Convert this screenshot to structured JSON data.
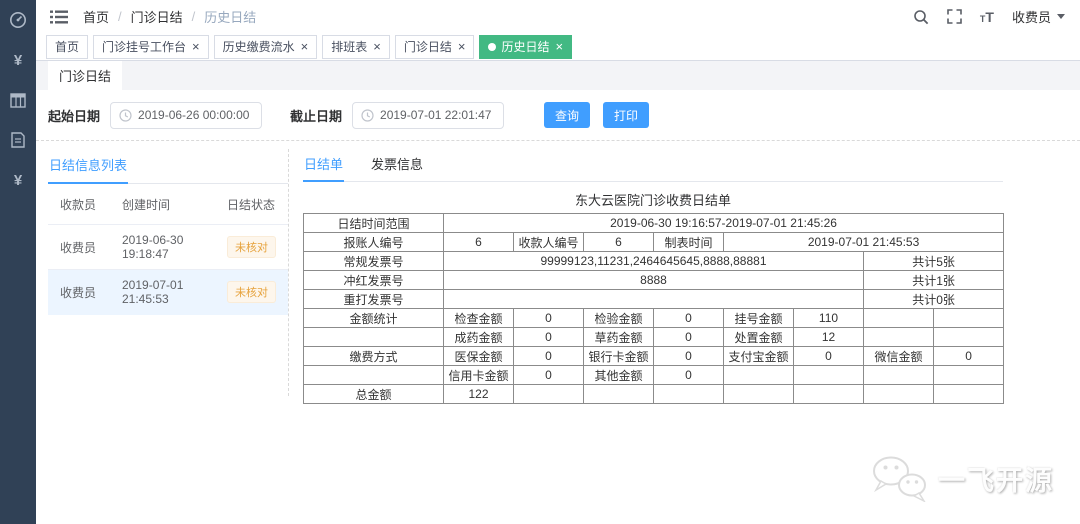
{
  "colors": {
    "accent_blue": "#409eff",
    "active_tag_green": "#42b983",
    "sidebar_bg": "#304156",
    "warning_orange": "#e6a23c",
    "warning_bg": "#fdf6ec",
    "selected_row_blue": "#ecf5ff"
  },
  "sidebar": {
    "icons": [
      "dashboard-icon",
      "yuan-icon",
      "table-icon",
      "document-icon",
      "yuan-icon"
    ]
  },
  "navbar": {
    "breadcrumb": {
      "items": [
        "首页",
        "门诊日结",
        "历史日结"
      ],
      "separator": "/"
    },
    "user_name": "收费员"
  },
  "tags_view": {
    "tabs": [
      {
        "label": "首页",
        "closable": false,
        "active": false
      },
      {
        "label": "门诊挂号工作台",
        "closable": true,
        "active": false
      },
      {
        "label": "历史缴费流水",
        "closable": true,
        "active": false
      },
      {
        "label": "排班表",
        "closable": true,
        "active": false
      },
      {
        "label": "门诊日结",
        "closable": true,
        "active": false
      },
      {
        "label": "历史日结",
        "closable": true,
        "active": true
      }
    ]
  },
  "page_tab": {
    "label": "门诊日结"
  },
  "query_form": {
    "start_label": "起始日期",
    "start_value": "2019-06-26 00:00:00",
    "end_label": "截止日期",
    "end_value": "2019-07-01 22:01:47",
    "search_button": "查询",
    "print_button": "打印"
  },
  "left_panel": {
    "tab_label": "日结信息列表",
    "columns": [
      "收款员",
      "创建时间",
      "日结状态"
    ],
    "rows": [
      {
        "cashier": "收费员",
        "created": "2019-06-30 19:18:47",
        "status": "未核对",
        "selected": false
      },
      {
        "cashier": "收费员",
        "created": "2019-07-01 21:45:53",
        "status": "未核对",
        "selected": true
      }
    ]
  },
  "main": {
    "tabs": [
      {
        "label": "日结单",
        "active": true
      },
      {
        "label": "发票信息",
        "active": false
      }
    ],
    "report": {
      "title": "东大云医院门诊收费日结单",
      "rows": [
        [
          "日结时间范围",
          "2019-06-30 19:16:57-2019-07-01 21:45:26"
        ],
        [
          "报账人编号",
          "6",
          "收款人编号",
          "6",
          "制表时间",
          "2019-07-01 21:45:53"
        ],
        [
          "常规发票号",
          "99999123,11231,2464645645,8888,88881",
          "共计5张"
        ],
        [
          "冲红发票号",
          "8888",
          "共计1张"
        ],
        [
          "重打发票号",
          "",
          "共计0张"
        ],
        [
          "金额统计",
          "检查金额",
          "0",
          "检验金额",
          "0",
          "挂号金额",
          "110",
          "",
          ""
        ],
        [
          "",
          "成药金额",
          "0",
          "草药金额",
          "0",
          "处置金额",
          "12",
          "",
          ""
        ],
        [
          "缴费方式",
          "医保金额",
          "0",
          "银行卡金额",
          "0",
          "支付宝金额",
          "0",
          "微信金额",
          "0"
        ],
        [
          "",
          "信用卡金额",
          "0",
          "其他金额",
          "0",
          "",
          "",
          "",
          ""
        ],
        [
          "总金额",
          "122",
          "",
          "",
          "",
          "",
          "",
          "",
          ""
        ]
      ]
    }
  },
  "watermark": {
    "text": "一飞开源"
  }
}
